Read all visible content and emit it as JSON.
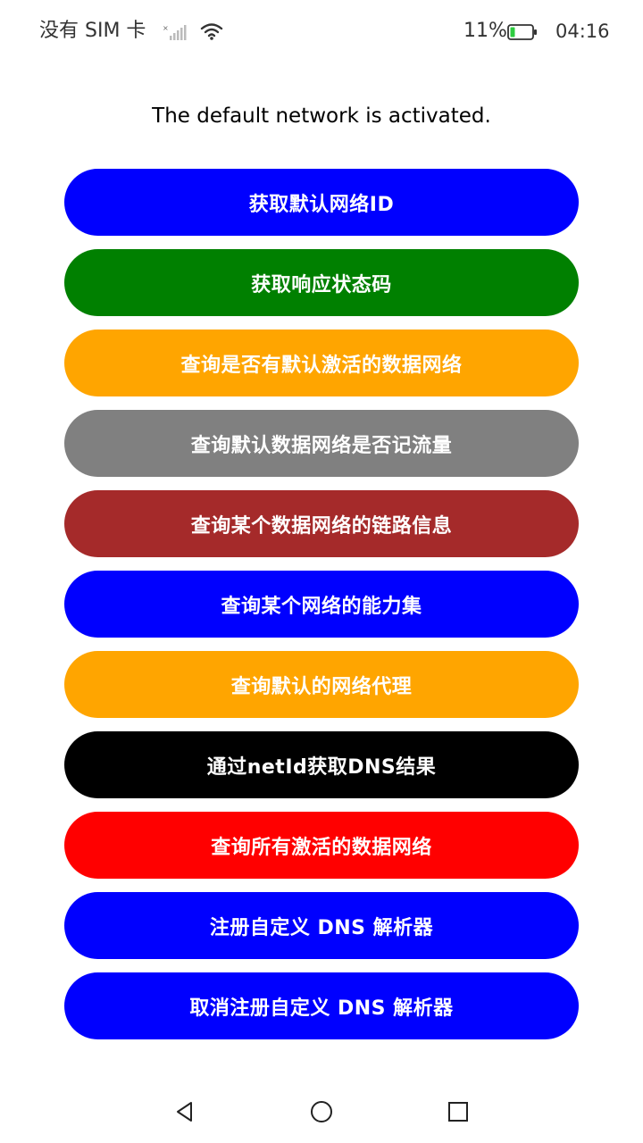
{
  "status_bar": {
    "carrier": "没有 SIM 卡",
    "battery_percent": "11%",
    "time": "04:16",
    "icons": [
      "signal-icon",
      "wifi-icon",
      "battery-icon"
    ]
  },
  "status_message": "The default network is activated.",
  "buttons": [
    {
      "label": "获取默认网络ID",
      "color": "#0000ff"
    },
    {
      "label": "获取响应状态码",
      "color": "#008000"
    },
    {
      "label": "查询是否有默认激活的数据网络",
      "color": "#ffa500"
    },
    {
      "label": "查询默认数据网络是否记流量",
      "color": "#808080"
    },
    {
      "label": "查询某个数据网络的链路信息",
      "color": "#a52a2a"
    },
    {
      "label": "查询某个网络的能力集",
      "color": "#0000ff"
    },
    {
      "label": "查询默认的网络代理",
      "color": "#ffa500"
    },
    {
      "label": "通过netId获取DNS结果",
      "color": "#000000"
    },
    {
      "label": "查询所有激活的数据网络",
      "color": "#ff0000"
    },
    {
      "label": "注册自定义 DNS 解析器",
      "color": "#0000ff"
    },
    {
      "label": "取消注册自定义 DNS 解析器",
      "color": "#0000ff"
    }
  ],
  "nav_bar": {
    "icons": [
      "back-triangle-icon",
      "home-circle-icon",
      "recents-square-icon"
    ]
  }
}
